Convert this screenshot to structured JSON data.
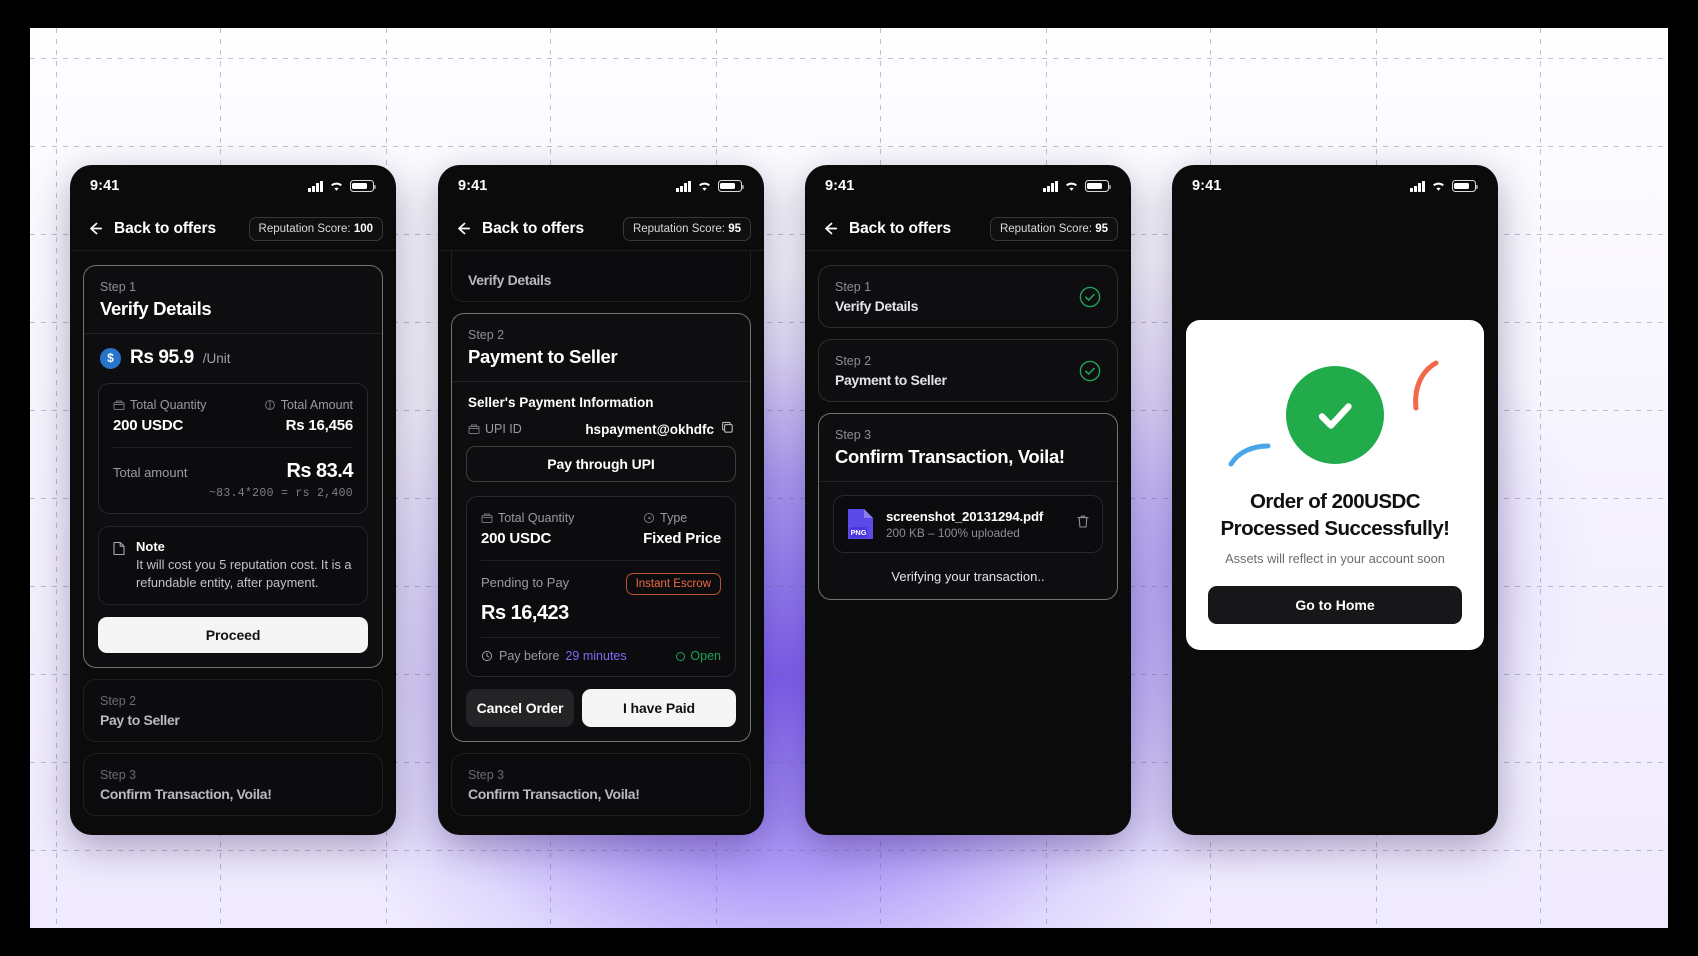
{
  "status_bar": {
    "time": "9:41"
  },
  "nav": {
    "back_label": "Back to offers",
    "reputation_prefix": "Reputation Score:",
    "reputation_100": "100",
    "reputation_95": "95"
  },
  "phone1": {
    "step1": {
      "step_label": "Step 1",
      "title": "Verify Details",
      "price_amount": "Rs 95.9",
      "price_unit": "/Unit",
      "total_quantity_label": "Total Quantity",
      "total_quantity_value": "200 USDC",
      "total_amount_label": "Total Amount",
      "total_amount_value": "Rs 16,456",
      "total_row_label": "Total amount",
      "total_row_value": "Rs 83.4",
      "calc": "~83.4*200 = rs 2,400",
      "note_title": "Note",
      "note_body": "It will cost you 5 reputation cost. It is a refundable entity, after payment.",
      "proceed_label": "Proceed"
    },
    "step2": {
      "step_label": "Step 2",
      "title": "Pay to Seller"
    },
    "step3": {
      "step_label": "Step 3",
      "title": "Confirm Transaction, Voila!"
    }
  },
  "phone2": {
    "clipped_title": "Verify Details",
    "step2": {
      "step_label": "Step 2",
      "title": "Payment to Seller",
      "section_title": "Seller's Payment Information",
      "upi_label": "UPI ID",
      "upi_value": "hspayment@okhdfc",
      "pay_upi_label": "Pay through UPI",
      "total_quantity_label": "Total Quantity",
      "total_quantity_value": "200 USDC",
      "type_label": "Type",
      "type_value": "Fixed Price",
      "pending_label": "Pending to Pay",
      "pending_value": "Rs 16,423",
      "escrow_badge": "Instant Escrow",
      "pay_before_label": "Pay before",
      "pay_before_time": "29 minutes",
      "status_open": "Open",
      "cancel_label": "Cancel Order",
      "paid_label": "I have Paid"
    },
    "step3": {
      "step_label": "Step 3",
      "title": "Confirm Transaction, Voila!"
    }
  },
  "phone3": {
    "step1": {
      "step_label": "Step 1",
      "title": "Verify Details"
    },
    "step2": {
      "step_label": "Step 2",
      "title": "Payment to Seller"
    },
    "step3": {
      "step_label": "Step 3",
      "title": "Confirm Transaction, Voila!",
      "file_name": "screenshot_20131294.pdf",
      "file_meta": "200 KB – 100% uploaded",
      "file_badge": "PNG",
      "verifying": "Verifying your transaction.."
    }
  },
  "phone4": {
    "title_line1": "Order of 200USDC",
    "title_line2": "Processed Successfully!",
    "subtitle": "Assets will reflect in your account soon",
    "home_label": "Go to Home"
  },
  "colors": {
    "accent_purple": "#7c5cf5",
    "success_green": "#22ab4b",
    "escrow_orange": "#ef6a43",
    "timer_purple": "#7b6cf0",
    "usdc_blue": "#2775ca",
    "file_indigo": "#5b4ae8"
  }
}
